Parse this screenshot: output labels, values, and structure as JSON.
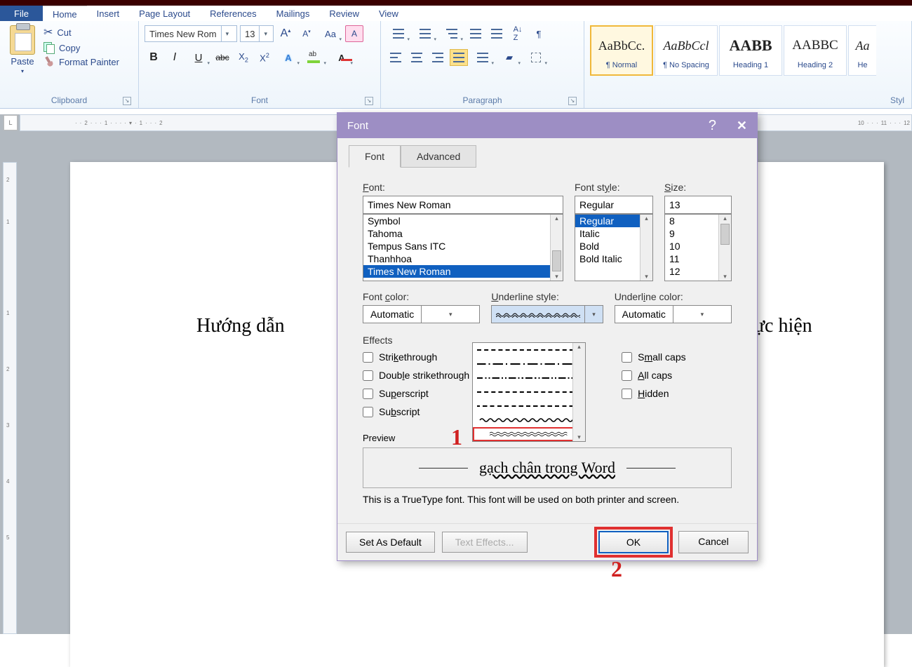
{
  "menu": {
    "file": "File",
    "tabs": [
      "Home",
      "Insert",
      "Page Layout",
      "References",
      "Mailings",
      "Review",
      "View"
    ]
  },
  "clipboard": {
    "paste": "Paste",
    "cut": "Cut",
    "copy": "Copy",
    "painter": "Format Painter",
    "label": "Clipboard"
  },
  "font": {
    "name": "Times New Rom",
    "size": "13",
    "label": "Font"
  },
  "paragraph": {
    "label": "Paragraph"
  },
  "styles": {
    "label": "Styl",
    "items": [
      {
        "sample": "AaBbCc.",
        "name": "¶ Normal",
        "serif": true,
        "sel": true
      },
      {
        "sample": "AaBbCcl",
        "name": "¶ No Spacing",
        "serif": true,
        "italic": true
      },
      {
        "sample": "AABB",
        "name": "Heading 1",
        "serif": true,
        "bold": true
      },
      {
        "sample": "AABBC",
        "name": "Heading 2",
        "serif": true
      },
      {
        "sample": "Aa",
        "name": "He",
        "serif": true,
        "italic": true
      }
    ]
  },
  "ruler": [
    "2",
    "1",
    "1",
    "2",
    "10",
    "11",
    "12"
  ],
  "vruler": [
    "2",
    "1",
    "1",
    "2",
    "3",
    "4",
    "5"
  ],
  "doc": {
    "left": "Hướng dẫn ",
    "right": "dễ thực hiện"
  },
  "dialog": {
    "title": "Font",
    "tabs": {
      "font": "Font",
      "adv": "Advanced"
    },
    "labels": {
      "font": "Font:",
      "style": "Font style:",
      "size": "Size:",
      "color": "Font color:",
      "ustyle": "Underline style:",
      "ucolor": "Underline color:"
    },
    "font_value": "Times New Roman",
    "font_list": [
      "Symbol",
      "Tahoma",
      "Tempus Sans ITC",
      "Thanhhoa",
      "Times New Roman"
    ],
    "style_value": "Regular",
    "style_list": [
      "Regular",
      "Italic",
      "Bold",
      "Bold Italic"
    ],
    "size_value": "13",
    "size_list": [
      "8",
      "9",
      "10",
      "11",
      "12"
    ],
    "color_value": "Automatic",
    "ucolor_value": "Automatic",
    "effects_label": "Effects",
    "effects_left": [
      "Strikethrough",
      "Double strikethrough",
      "Superscript",
      "Subscript"
    ],
    "effects_right": [
      "Small caps",
      "All caps",
      "Hidden"
    ],
    "preview_label": "Preview",
    "preview_text": "gạch chân trong Word",
    "preview_note": "This is a TrueType font. This font will be used on both printer and screen.",
    "btn_default": "Set As Default",
    "btn_texteff": "Text Effects...",
    "btn_ok": "OK",
    "btn_cancel": "Cancel"
  },
  "annotation": {
    "one": "1",
    "two": "2"
  }
}
